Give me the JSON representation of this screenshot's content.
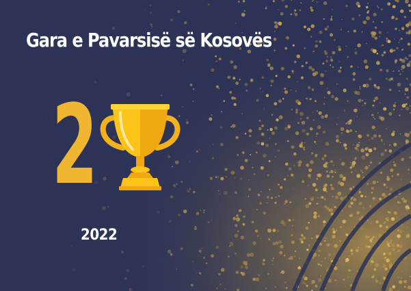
{
  "card": {
    "title": "Gara e Pavarsisë së Kosovës",
    "rank": "2",
    "year": "2022",
    "trophy_icon": "trophy-icon"
  },
  "colors": {
    "background": "#2d3356",
    "accent_gold": "#f1b630",
    "text": "#ffffff"
  }
}
